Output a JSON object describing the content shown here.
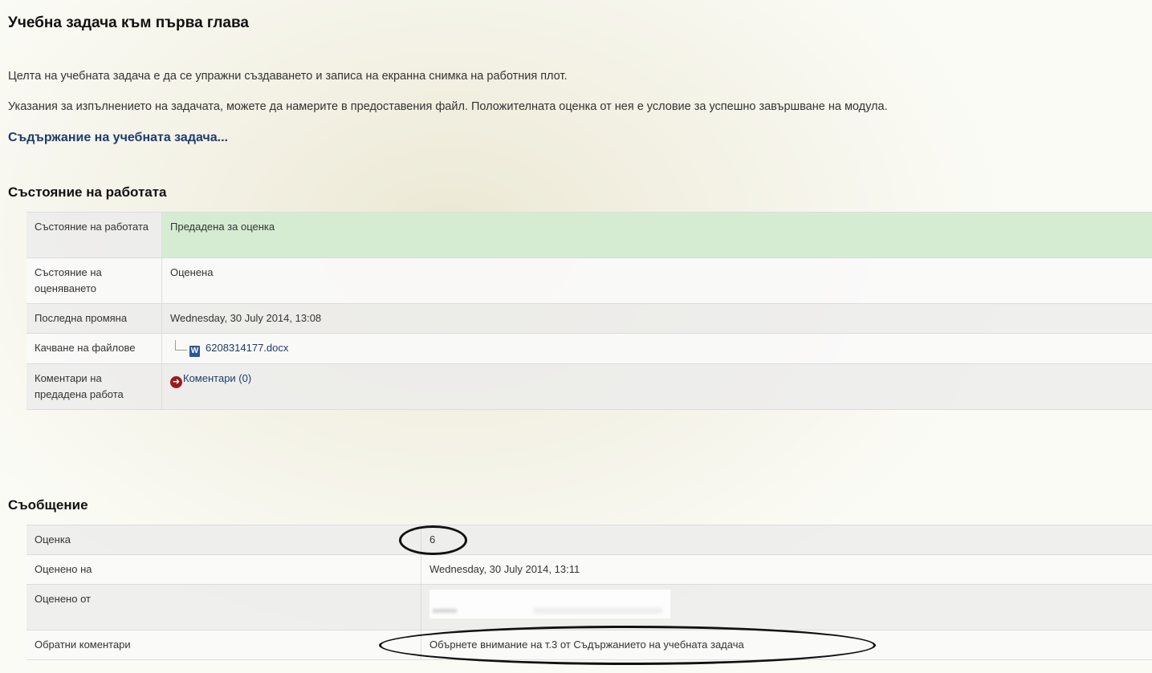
{
  "assignment": {
    "title": "Учебна задача към първа глава",
    "intro": "Целта на учебната задача е да се упражни създаването и записа на екранна снимка на работния плот.",
    "instructions": "Указания за изпълнението на задачата, можете да намерите в предоставения файл. Положителната оценка от нея е условие за успешно завършване на модула.",
    "content_link": "Съдържание на учебната задача..."
  },
  "submission_status": {
    "heading": "Състояние на работата",
    "rows": [
      {
        "label": "Състояние на работата",
        "value": "Предадена за оценка"
      },
      {
        "label": "Състояние на оценяването",
        "value": "Оценена"
      },
      {
        "label": "Последна промяна",
        "value": "Wednesday, 30 July 2014, 13:08"
      },
      {
        "label": "Качване на файлове",
        "value": "6208314177.docx",
        "icon": "word-file-icon"
      },
      {
        "label": "Коментари на предадена работа",
        "value": "Коментари (0)",
        "icon": "arrow-right-circle-icon"
      }
    ]
  },
  "feedback": {
    "heading": "Съобщение",
    "rows": [
      {
        "label": "Оценка",
        "value": "6"
      },
      {
        "label": "Оценено на",
        "value": "Wednesday, 30 July 2014, 13:11"
      },
      {
        "label": "Оценено от",
        "value": ""
      },
      {
        "label": "Обратни коментари",
        "value": "Обърнете внимание на т.3 от Съдържанието на учебната задача"
      }
    ]
  },
  "colors": {
    "link": "#1f3b6e",
    "submitted_highlight": "#d5ecd3",
    "comment_icon": "#9b1a1e"
  }
}
